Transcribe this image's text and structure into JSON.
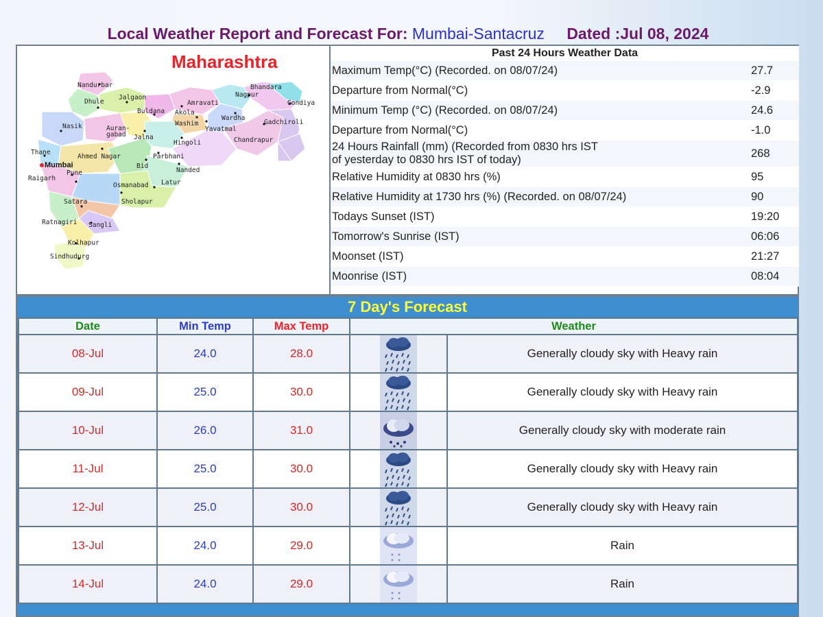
{
  "header": {
    "prefix": "Local Weather Report and Forecast For:",
    "location": "Mumbai-Santacruz",
    "dated": "Dated :Jul 08, 2024"
  },
  "map": {
    "title": "Maharashtra",
    "labels": {
      "nandurbar": "Nandurbar",
      "dhule": "Dhule",
      "jalgaon": "Jalgaon",
      "buldana": "Buldana",
      "akola": "Akola",
      "amravati": "Amravati",
      "bhandara": "Bhandara",
      "nagpur": "Nagpur",
      "gondiya": "Gondiya",
      "washim": "Washim",
      "wardha": "Wardha",
      "yavatmal": "Yavatmal",
      "gadchiroli": "Gadchiroli",
      "nasik": "Nasik",
      "aurangabad_1": "Auran-",
      "aurangabad_2": "gabad",
      "jalna": "Jalna",
      "hingoli": "Hingoli",
      "chandrapur": "Chandrapur",
      "thane": "Thane",
      "ahmednagar": "Ahmed Nagar",
      "parbhani": "Parbhani",
      "mumbai": "Mumbai",
      "bid": "Bid",
      "nanded": "Nanded",
      "pune": "Pune",
      "raigarh": "Raigarh",
      "latur": "Latur",
      "osmanabad": "Osmanabad",
      "satara": "Satara",
      "sholapur": "Sholapur",
      "ratnagiri": "Ratnagiri",
      "sangli": "Sangli",
      "kolhapur": "Kolhapur",
      "sindhudurg": "Sindhudurg"
    }
  },
  "past24": {
    "heading": "Past 24 Hours Weather Data",
    "rows": [
      {
        "label": "Maximum Temp(°C) (Recorded. on 08/07/24)",
        "value": "27.7"
      },
      {
        "label": "Departure from Normal(°C)",
        "value": "-2.9"
      },
      {
        "label": "Minimum Temp (°C) (Recorded. on 08/07/24)",
        "value": "24.6"
      },
      {
        "label": "Departure from Normal(°C)",
        "value": "-1.0"
      },
      {
        "label": "24 Hours Rainfall (mm) (Recorded from 0830 hrs IST",
        "label2": "of yesterday to 0830 hrs IST of today)",
        "value": "268"
      },
      {
        "label": "Relative Humidity at 0830 hrs (%)",
        "value": "95"
      },
      {
        "label": "Relative Humidity at 1730 hrs (%) (Recorded. on 08/07/24)",
        "value": "90"
      },
      {
        "label": "Todays Sunset (IST)",
        "value": "19:20"
      },
      {
        "label": "Tomorrow's Sunrise (IST)",
        "value": "06:06"
      },
      {
        "label": "Moonset (IST)",
        "value": "21:27"
      },
      {
        "label": "Moonrise (IST)",
        "value": "08:04"
      }
    ]
  },
  "forecast": {
    "title": "7 Day's Forecast",
    "headers": {
      "date": "Date",
      "min": "Min Temp",
      "max": "Max Temp",
      "weather": "Weather"
    },
    "colors": {
      "date_header": "#1a8a1a",
      "min_header": "#2a3cc8",
      "max_header": "#e8232a",
      "weather_header": "#1a8a1a"
    },
    "rows": [
      {
        "date": "08-Jul",
        "min": "24.0",
        "max": "28.0",
        "icon": "heavy-rain-icon",
        "weather": "Generally cloudy sky with Heavy rain"
      },
      {
        "date": "09-Jul",
        "min": "25.0",
        "max": "30.0",
        "icon": "heavy-rain-icon",
        "weather": "Generally cloudy sky with Heavy rain"
      },
      {
        "date": "10-Jul",
        "min": "26.0",
        "max": "31.0",
        "icon": "moderate-rain-icon",
        "weather": "Generally cloudy sky with moderate rain"
      },
      {
        "date": "11-Jul",
        "min": "25.0",
        "max": "30.0",
        "icon": "heavy-rain-icon",
        "weather": "Generally cloudy sky with Heavy rain"
      },
      {
        "date": "12-Jul",
        "min": "25.0",
        "max": "30.0",
        "icon": "heavy-rain-icon",
        "weather": "Generally cloudy sky with Heavy rain"
      },
      {
        "date": "13-Jul",
        "min": "24.0",
        "max": "29.0",
        "icon": "rain-icon",
        "weather": "Rain"
      },
      {
        "date": "14-Jul",
        "min": "24.0",
        "max": "29.0",
        "icon": "rain-icon",
        "weather": "Rain"
      }
    ]
  }
}
